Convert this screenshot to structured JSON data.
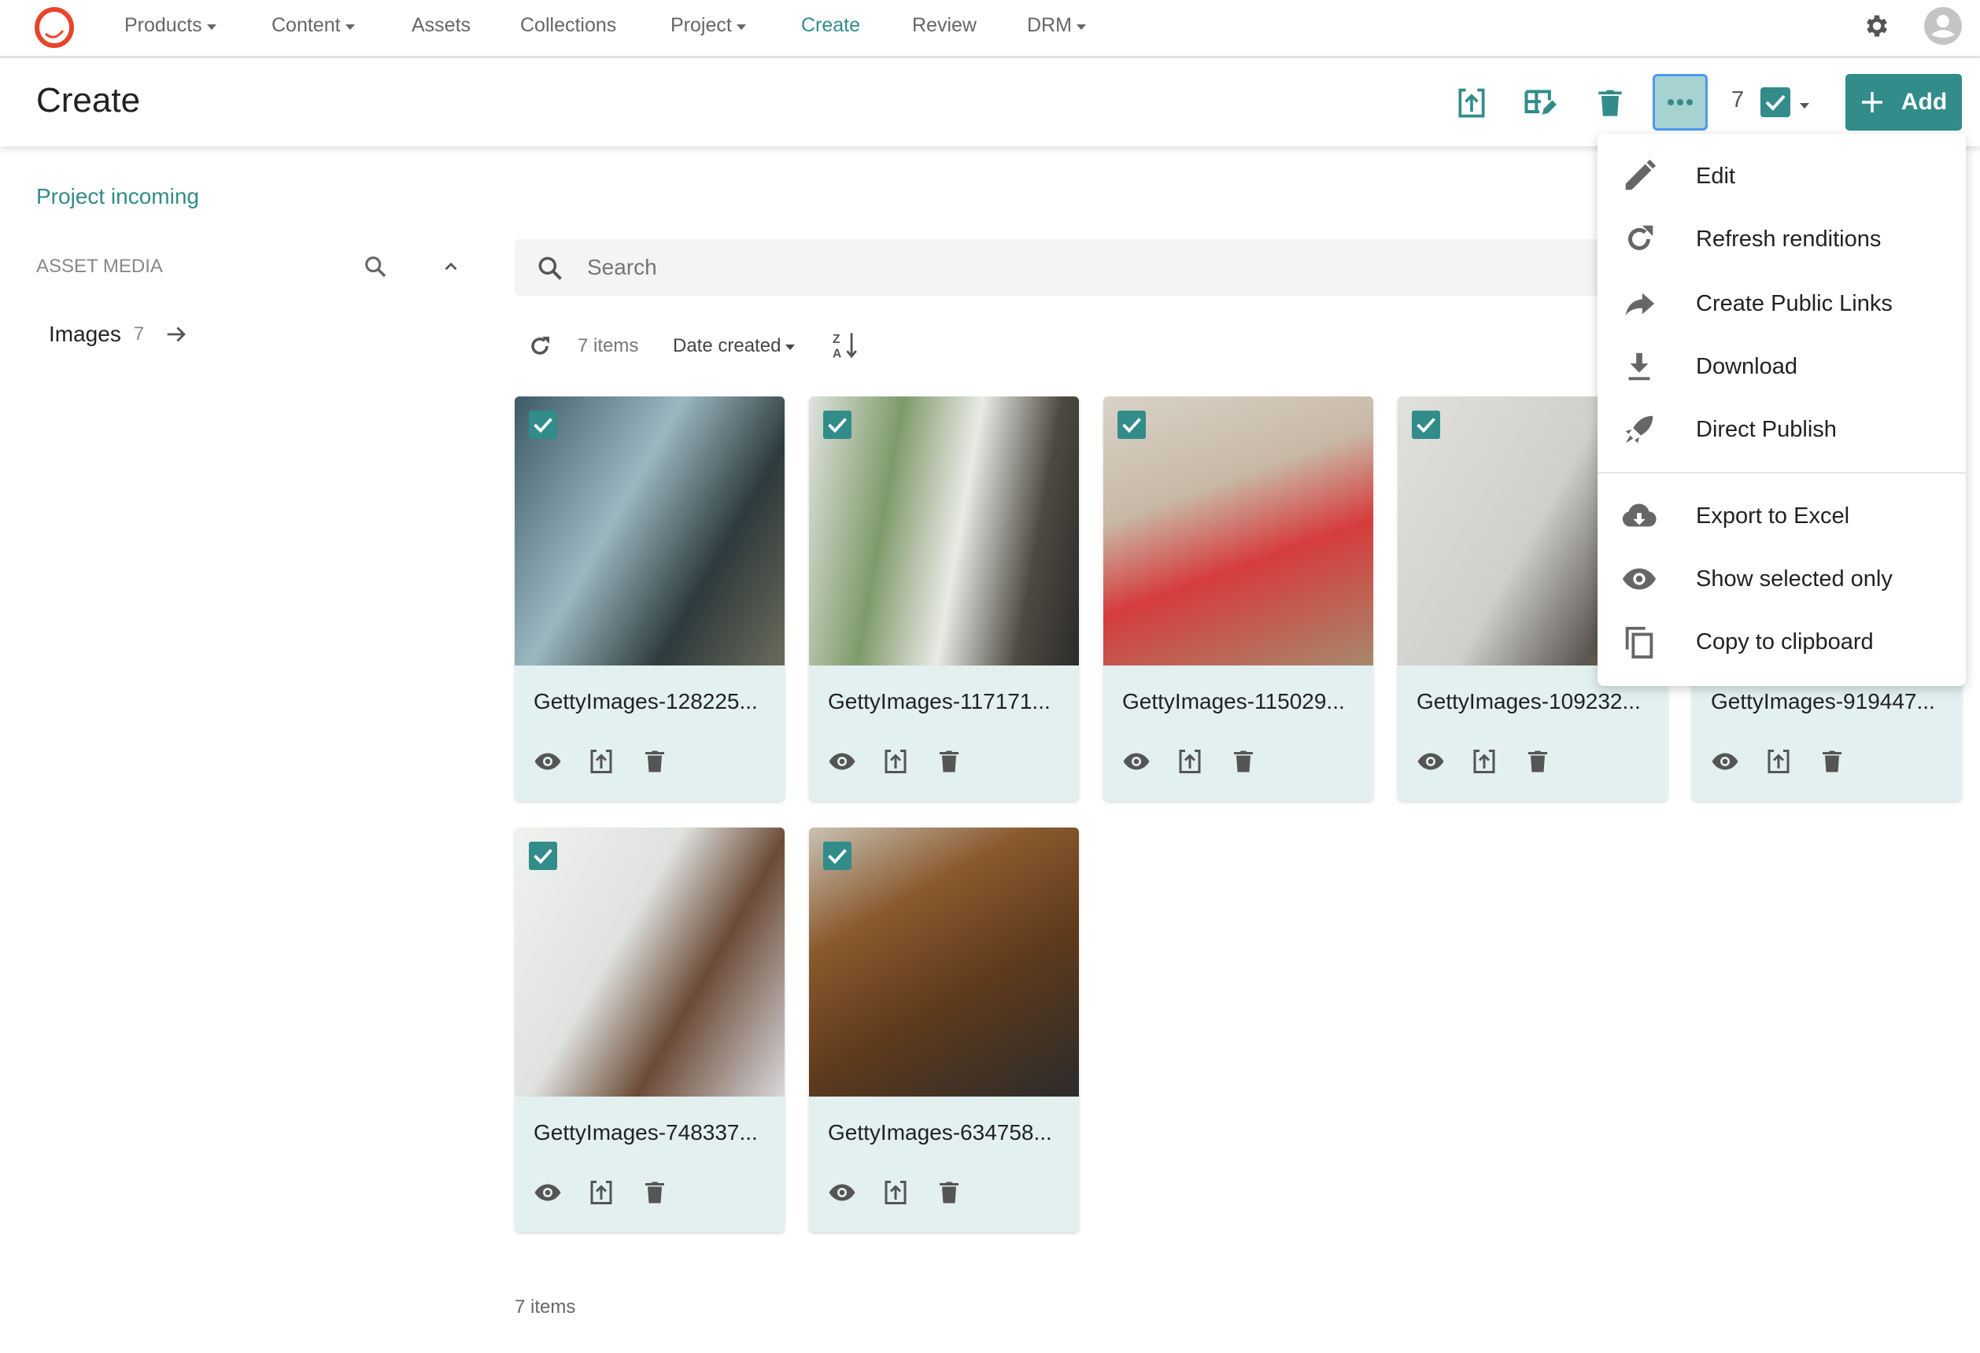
{
  "nav": {
    "items": [
      {
        "label": "Products",
        "dropdown": true
      },
      {
        "label": "Content",
        "dropdown": true
      },
      {
        "label": "Assets",
        "dropdown": false
      },
      {
        "label": "Collections",
        "dropdown": false
      },
      {
        "label": "Project",
        "dropdown": true
      },
      {
        "label": "Create",
        "dropdown": false,
        "active": true
      },
      {
        "label": "Review",
        "dropdown": false
      },
      {
        "label": "DRM",
        "dropdown": true
      }
    ]
  },
  "header": {
    "title": "Create",
    "selected_count": "7",
    "add_label": "Add"
  },
  "sidebar": {
    "project_link": "Project incoming",
    "section_title": "ASSET MEDIA",
    "items": [
      {
        "label": "Images",
        "count": "7"
      }
    ]
  },
  "search": {
    "placeholder": "Search"
  },
  "list_toolbar": {
    "count": "7 items",
    "sort_label": "Date created"
  },
  "assets": [
    {
      "name": "GettyImages-128225...",
      "selected": true
    },
    {
      "name": "GettyImages-117171...",
      "selected": true
    },
    {
      "name": "GettyImages-115029...",
      "selected": true
    },
    {
      "name": "GettyImages-109232...",
      "selected": true
    },
    {
      "name": "GettyImages-919447...",
      "selected": true
    },
    {
      "name": "GettyImages-748337...",
      "selected": true
    },
    {
      "name": "GettyImages-634758...",
      "selected": true
    }
  ],
  "footer": {
    "count": "7 items"
  },
  "menu": {
    "items": [
      {
        "label": "Edit",
        "icon": "pencil-icon"
      },
      {
        "label": "Refresh renditions",
        "icon": "refresh-icon"
      },
      {
        "label": "Create Public Links",
        "icon": "share-icon"
      },
      {
        "label": "Download",
        "icon": "download-icon"
      },
      {
        "label": "Direct Publish",
        "icon": "rocket-icon"
      },
      {
        "label": "Export to Excel",
        "icon": "cloud-download-icon"
      },
      {
        "label": "Show selected only",
        "icon": "eye-icon"
      },
      {
        "label": "Copy to clipboard",
        "icon": "copy-icon"
      }
    ]
  },
  "colors": {
    "accent": "#318c8a",
    "card_bg": "#e2f0f0",
    "logo": "#e8442c"
  }
}
